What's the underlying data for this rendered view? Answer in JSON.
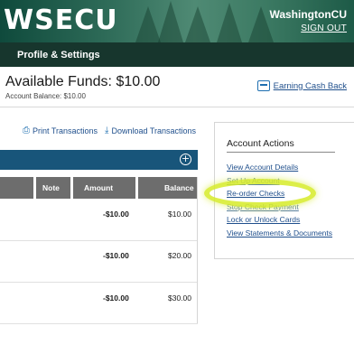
{
  "header": {
    "logo": "WSECU",
    "user_name": "WashingtonCU",
    "sign_out": "SIGN OUT"
  },
  "nav": {
    "active": "Profile & Settings"
  },
  "funds": {
    "label": "Available Funds:",
    "amount": "$10.00",
    "account_balance": "Account Balance: $10.00",
    "earning_link": "Earning Cash Back"
  },
  "transactions": {
    "print": "Print Transactions",
    "download": "Download Transactions",
    "columns": [
      "Note",
      "Amount",
      "Balance"
    ],
    "rows": [
      {
        "amount": "-$10.00",
        "balance": "$10.00"
      },
      {
        "amount": "-$10.00",
        "balance": "$20.00"
      },
      {
        "amount": "-$10.00",
        "balance": "$30.00"
      }
    ]
  },
  "account_actions": {
    "title": "Account Actions",
    "links": [
      "View Account Details",
      "Set Up Account",
      "Re-order Checks",
      "Stop Check Payment",
      "Lock or Unlock Cards",
      "View Statements & Documents"
    ]
  },
  "colors": {
    "header_green": "#17362d",
    "link_blue": "#1f4f8c",
    "bar_blue": "#18557a",
    "highlight": "#d6eb28"
  }
}
